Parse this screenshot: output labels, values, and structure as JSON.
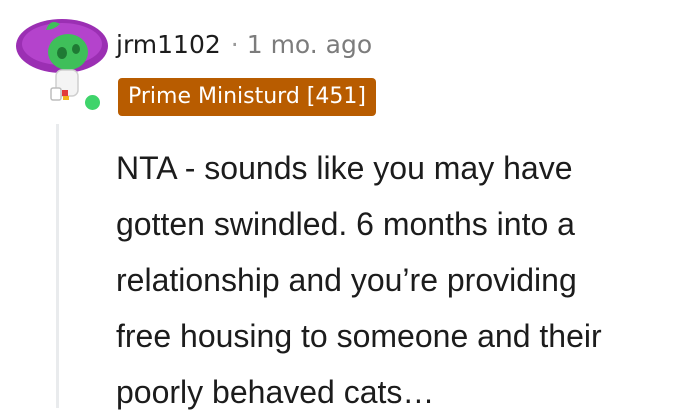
{
  "comment": {
    "avatar_icon": "snoo-avatar-icon",
    "username": "jrm1102",
    "separator": "·",
    "timestamp": "1 mo. ago",
    "flair": "Prime Ministurd [451]",
    "body_lines": [
      "NTA - sounds like you may have",
      "gotten swindled. 6 months into a",
      "relationship and you’re providing",
      "free housing to someone and their",
      "poorly behaved cats…"
    ]
  },
  "colors": {
    "flair_bg": "#b85c00",
    "online": "#3fd46b",
    "avatar_purple": "#9b2fb3",
    "avatar_green": "#3fbf5a",
    "thread_line": "#e9ebed"
  }
}
